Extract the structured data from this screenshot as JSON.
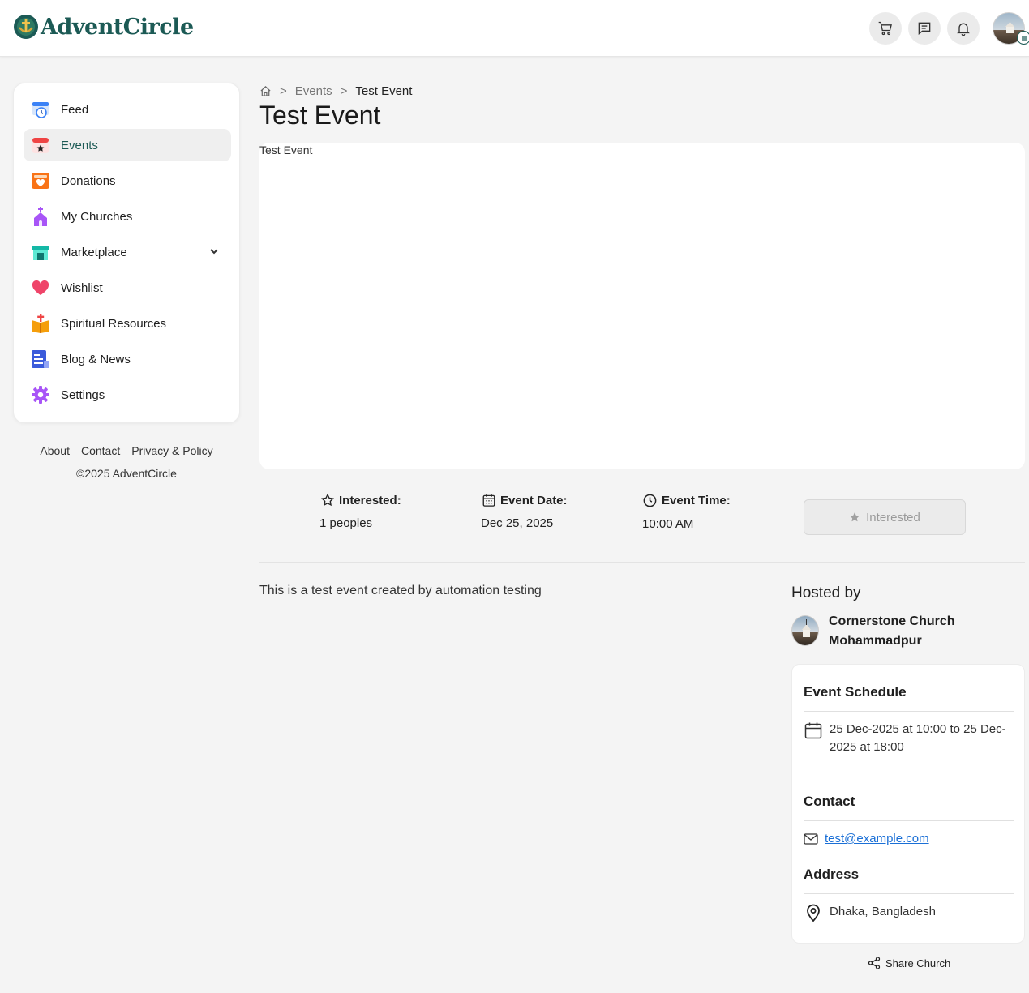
{
  "app": {
    "name": "AdventCircle"
  },
  "header": {
    "cart_icon": "cart-icon",
    "messages_icon": "messages-icon",
    "notifications_icon": "bell-icon"
  },
  "sidebar": {
    "items": [
      {
        "label": "Feed",
        "icon": "feed-icon"
      },
      {
        "label": "Events",
        "icon": "calendar-icon",
        "active": true
      },
      {
        "label": "Donations",
        "icon": "donation-box-icon"
      },
      {
        "label": "My Churches",
        "icon": "church-icon"
      },
      {
        "label": "Marketplace",
        "icon": "store-icon",
        "has_submenu": true
      },
      {
        "label": "Wishlist",
        "icon": "heart-icon"
      },
      {
        "label": "Spiritual Resources",
        "icon": "bible-icon"
      },
      {
        "label": "Blog & News",
        "icon": "news-icon"
      },
      {
        "label": "Settings",
        "icon": "gear-icon"
      }
    ]
  },
  "footer": {
    "links": [
      "About",
      "Contact",
      "Privacy & Policy"
    ],
    "copyright": "©2025 AdventCircle"
  },
  "breadcrumb": {
    "sep1": ">",
    "events": "Events",
    "sep2": ">",
    "current": "Test Event"
  },
  "event": {
    "title": "Test Event",
    "image_alt": "Test Event",
    "interested_label": "Interested:",
    "interested_value": "1 peoples",
    "date_label": "Event Date:",
    "date_value": "Dec 25, 2025",
    "time_label": "Event Time:",
    "time_value": "10:00 AM",
    "interested_button": "Interested",
    "description": "This is a test event created by automation testing"
  },
  "host": {
    "title": "Hosted by",
    "name": "Cornerstone Church Mohammadpur"
  },
  "details": {
    "schedule_title": "Event Schedule",
    "schedule_text": "25 Dec-2025 at 10:00 to 25 Dec-2025 at 18:00",
    "contact_title": "Contact",
    "email": "test@example.com",
    "address_title": "Address",
    "address": "Dhaka, Bangladesh"
  },
  "share_label": "Share Church",
  "colors": {
    "brand": "#1c5a55",
    "link": "#1a6fd6",
    "background": "#f4f4f4"
  }
}
